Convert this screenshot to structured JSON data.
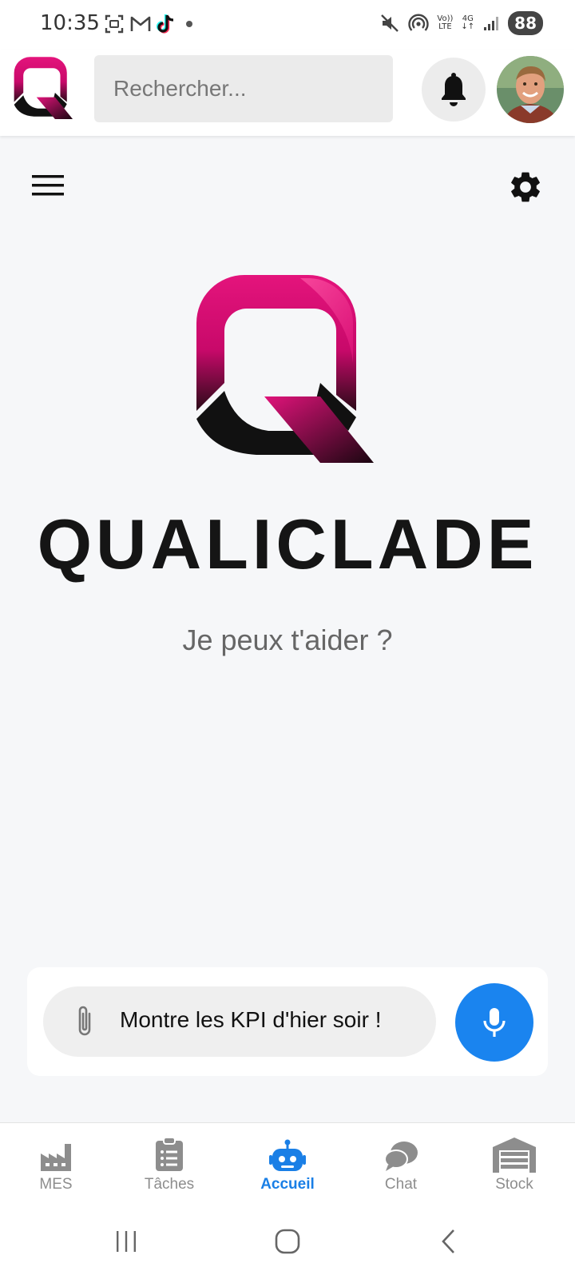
{
  "status_bar": {
    "time": "10:35",
    "battery": "88",
    "volte_top": "Vo))",
    "volte_bottom": "LTE",
    "network": "4G"
  },
  "header": {
    "search_placeholder": "Rechercher..."
  },
  "main": {
    "brand_name": "QUALICLADE",
    "prompt": "Je peux t'aider ?"
  },
  "chat_input": {
    "value": "Montre les KPI d'hier soir !"
  },
  "bottom_nav": {
    "items": [
      {
        "label": "MES",
        "icon": "factory-icon"
      },
      {
        "label": "Tâches",
        "icon": "clipboard-list-icon"
      },
      {
        "label": "Accueil",
        "icon": "robot-icon",
        "active": true
      },
      {
        "label": "Chat",
        "icon": "chat-bubble-icon"
      },
      {
        "label": "Stock",
        "icon": "warehouse-icon"
      }
    ]
  },
  "colors": {
    "brand_magenta": "#e0137a",
    "accent_blue": "#1a84ef",
    "active_nav": "#1a7fe6",
    "inactive_nav": "#8d8d8d"
  }
}
